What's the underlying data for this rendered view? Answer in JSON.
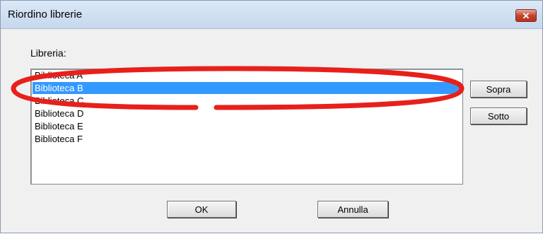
{
  "window": {
    "title": "Riordino librerie",
    "close_glyph": "✕"
  },
  "list_label": "Libreria:",
  "libraries": [
    {
      "label": "Biblioteca A",
      "selected": false
    },
    {
      "label": "Biblioteca B",
      "selected": true
    },
    {
      "label": "Biblioteca C",
      "selected": false
    },
    {
      "label": "Biblioteca D",
      "selected": false
    },
    {
      "label": "Biblioteca E",
      "selected": false
    },
    {
      "label": "Biblioteca F",
      "selected": false
    }
  ],
  "buttons": {
    "up": "Sopra",
    "down": "Sotto",
    "ok": "OK",
    "cancel": "Annulla"
  },
  "colors": {
    "selection": "#3399ff",
    "annotation": "#e8201a"
  }
}
